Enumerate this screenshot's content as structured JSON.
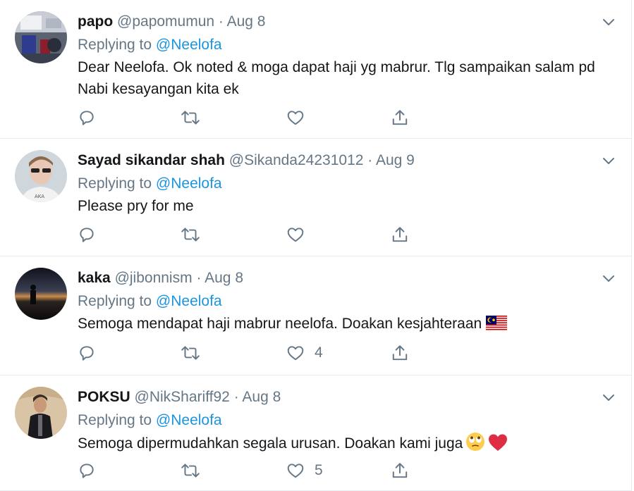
{
  "tweets": [
    {
      "name": "papo",
      "handle": "@papomumun",
      "sep": "·",
      "date": "Aug 8",
      "replying_prefix": "Replying to",
      "replying_to": "@Neelofa",
      "text": "Dear Neelofa. Ok noted & moga dapat haji yg mabrur. Tlg sampaikan salam pd Nabi kesayangan kita ek",
      "like_count": ""
    },
    {
      "name": "Sayad sikandar shah",
      "handle": "@Sikanda24231012",
      "sep": "·",
      "date": "Aug 9",
      "replying_prefix": "Replying to",
      "replying_to": "@Neelofa",
      "text": "Please pry for me",
      "like_count": ""
    },
    {
      "name": "kaka",
      "handle": "@jibonnism",
      "sep": "·",
      "date": "Aug 8",
      "replying_prefix": "Replying to",
      "replying_to": "@Neelofa",
      "text": "Semoga mendapat haji mabrur neelofa. Doakan kesjahteraan",
      "emoji": "malaysia-flag",
      "like_count": "4"
    },
    {
      "name": "POKSU",
      "handle": "@NikShariff92",
      "sep": "·",
      "date": "Aug 8",
      "replying_prefix": "Replying to",
      "replying_to": "@Neelofa",
      "text": "Semoga dipermudahkan segala urusan. Doakan kami juga",
      "emoji": "eye-roll-face, red-heart",
      "like_count": "5"
    }
  ],
  "colors": {
    "text": "#14171a",
    "secondary": "#657786",
    "link": "#1b95e0",
    "divider": "#e6ecf0"
  },
  "icons": [
    "reply-icon",
    "retweet-icon",
    "like-icon",
    "share-icon",
    "chevron-down-icon"
  ]
}
